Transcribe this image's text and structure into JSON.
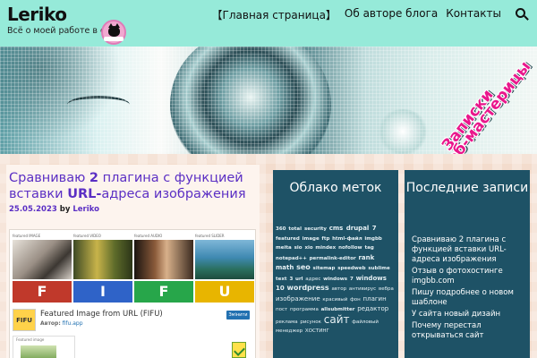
{
  "header": {
    "site_title": "Leriko",
    "tagline": "Всё о моей работе в сети",
    "nav": [
      "【Главная страница】",
      "Об авторе блога",
      "Контакты"
    ]
  },
  "banner": {
    "line1": "Записки",
    "line2": "вэб-мастерицы"
  },
  "article": {
    "title_parts": [
      "Сравниваю ",
      "2",
      " плагина с функцией вставки ",
      "URL-",
      "адреса изображения"
    ],
    "date": "25.05.2023",
    "by": "by",
    "author": "Leriko",
    "screenshot": {
      "tiles": [
        {
          "label": "featured IMAGE",
          "letter": "F",
          "color": "#c0392b"
        },
        {
          "label": "featured VIDEO",
          "letter": "I",
          "color": "#2f63c8"
        },
        {
          "label": "featured AUDIO",
          "letter": "F",
          "color": "#27a64a"
        },
        {
          "label": "featured SLIDER",
          "letter": "U",
          "color": "#e8b500"
        }
      ],
      "plugin_icon": "FIFU",
      "plugin_name": "Featured Image from URL (FIFU)",
      "plugin_author_prefix": "Автор:",
      "plugin_author": "fifu.app",
      "install_button": "Змінити",
      "featured_box_label": "Featured image"
    }
  },
  "tag_cloud": {
    "title": "Облако меток",
    "tags": [
      {
        "t": "360 total security",
        "c": "b"
      },
      {
        "t": "cms drupal 7",
        "c": "b m"
      },
      {
        "t": "featured image",
        "c": "b"
      },
      {
        "t": "ftp",
        "c": "b"
      },
      {
        "t": "html-файл",
        "c": "b"
      },
      {
        "t": "imgbb",
        "c": "b"
      },
      {
        "t": "meita sio xio",
        "c": "b"
      },
      {
        "t": "mindex nofollow tag",
        "c": "b"
      },
      {
        "t": "notepad++",
        "c": "b"
      },
      {
        "t": "permalink-editor",
        "c": "b"
      },
      {
        "t": "rank math",
        "c": "b m"
      },
      {
        "t": "seo",
        "c": "b l"
      },
      {
        "t": "sitemap",
        "c": "b"
      },
      {
        "t": "speedweb",
        "c": "b"
      },
      {
        "t": "sublime text 3",
        "c": "b"
      },
      {
        "t": "url",
        "c": "b"
      },
      {
        "t": "адрес",
        "c": ""
      },
      {
        "t": "windows 7",
        "c": "b"
      },
      {
        "t": "windows 10",
        "c": "b m"
      },
      {
        "t": "wordpress",
        "c": "b l"
      },
      {
        "t": "автор",
        "c": ""
      },
      {
        "t": "антивирус",
        "c": ""
      },
      {
        "t": "вебра",
        "c": ""
      },
      {
        "t": "изображение",
        "c": "m"
      },
      {
        "t": "красивый фон",
        "c": ""
      },
      {
        "t": "плагин",
        "c": "m"
      },
      {
        "t": "пост",
        "c": ""
      },
      {
        "t": "программа",
        "c": ""
      },
      {
        "t": "allsubmitter",
        "c": "b"
      },
      {
        "t": "редактор",
        "c": "m"
      },
      {
        "t": "реклама",
        "c": ""
      },
      {
        "t": "рисунок",
        "c": ""
      },
      {
        "t": "сайт",
        "c": "xl"
      },
      {
        "t": "файловый менеджер",
        "c": ""
      },
      {
        "t": "ХОСТИНГ",
        "c": ""
      }
    ]
  },
  "recent": {
    "title": "Последние записи",
    "items": [
      "Сравниваю 2 плагина с функцией вставки URL-адреса изображения",
      "Отзыв о фотохостинге imgbb.com",
      "Пишу подробнее о новом шаблоне",
      "У сайта новый дизайн",
      "Почему перестал открываться сайт"
    ]
  },
  "colors": {
    "header_bg": "#96ead9",
    "link": "#5b2fc4",
    "widget_bg": "#1e5266",
    "banner_text": "#e9178c"
  }
}
